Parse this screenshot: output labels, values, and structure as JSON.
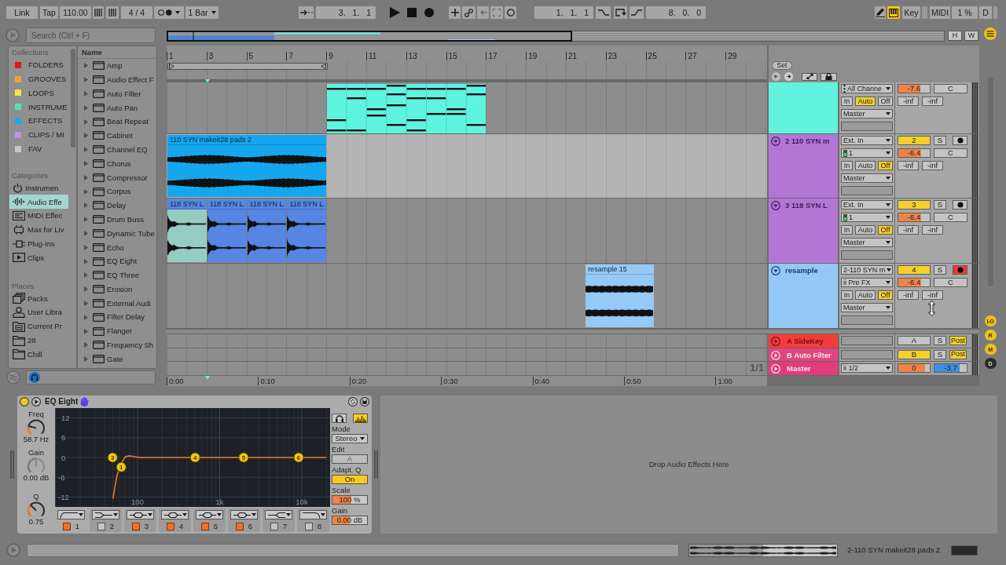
{
  "control_bar": {
    "link": "Link",
    "tap": "Tap",
    "tempo": "110.00",
    "signature": "4 / 4",
    "quantization": "1 Bar",
    "arrangement_position": "3. 1. 1",
    "loop_start": "1. 1. 1",
    "loop_length": "8. 0. 0",
    "draw_mode_on": false,
    "keys_on": true,
    "key": "Key",
    "midi": "MIDI",
    "cpu_load": "1 %",
    "disk_overload": "D"
  },
  "browser": {
    "search": {
      "placeholder": "Search (Ctrl + F)"
    },
    "collections": {
      "title": "Collections",
      "items": [
        {
          "label": "FOLDERS",
          "color": "#e3161d",
          "selected": false
        },
        {
          "label": "GROOVES",
          "color": "#f2a03c",
          "selected": false
        },
        {
          "label": "LOOPS",
          "color": "#f2e648",
          "selected": false
        },
        {
          "label": "INSTRUME",
          "color": "#4de6a6",
          "selected": false
        },
        {
          "label": "EFFECTS",
          "color": "#22a6f0",
          "selected": false
        },
        {
          "label": "CLIPS / MI",
          "color": "#b693f5",
          "selected": false
        },
        {
          "label": "FAV",
          "color": "#c6c6c6",
          "selected": false
        }
      ]
    },
    "categories": {
      "title": "Categories",
      "items": [
        {
          "label": "Instrumen",
          "selected": false
        },
        {
          "label": "Audio Effe",
          "selected": true
        },
        {
          "label": "MIDI Effec",
          "selected": false
        },
        {
          "label": "Max for Liv",
          "selected": false
        },
        {
          "label": "Plug-Ins",
          "selected": false
        },
        {
          "label": "Clips",
          "selected": false
        }
      ]
    },
    "places": {
      "title": "Places",
      "items": [
        {
          "label": "Packs",
          "selected": false
        },
        {
          "label": "User Libra",
          "selected": false
        },
        {
          "label": "Current Pr",
          "selected": false
        },
        {
          "label": "28",
          "selected": false
        },
        {
          "label": "Chill",
          "selected": false
        }
      ]
    },
    "name_header": "Name",
    "items": [
      {
        "label": "Amp",
        "selected": false
      },
      {
        "label": "Audio Effect F",
        "selected": false
      },
      {
        "label": "Auto Filter",
        "selected": false
      },
      {
        "label": "Auto Pan",
        "selected": false
      },
      {
        "label": "Beat Repeat",
        "selected": false
      },
      {
        "label": "Cabinet",
        "selected": false
      },
      {
        "label": "Channel EQ",
        "selected": false
      },
      {
        "label": "Chorus",
        "selected": false
      },
      {
        "label": "Compressor",
        "selected": false
      },
      {
        "label": "Corpus",
        "selected": false
      },
      {
        "label": "Delay",
        "selected": false
      },
      {
        "label": "Drum Buss",
        "selected": false
      },
      {
        "label": "Dynamic Tube",
        "selected": false
      },
      {
        "label": "Echo",
        "selected": false
      },
      {
        "label": "EQ Eight",
        "selected": false
      },
      {
        "label": "EQ Three",
        "selected": false
      },
      {
        "label": "Erosion",
        "selected": false
      },
      {
        "label": "External Audi",
        "selected": false
      },
      {
        "label": "Filter Delay",
        "selected": false
      },
      {
        "label": "Flanger",
        "selected": false
      },
      {
        "label": "Frequency Sh",
        "selected": false
      },
      {
        "label": "Gate",
        "selected": false
      }
    ]
  },
  "overview": {
    "h_button": "H",
    "w_button": "W"
  },
  "arrangement": {
    "bar_numbers": [
      "1",
      "3",
      "5",
      "7",
      "9",
      "11",
      "13",
      "15",
      "17",
      "19",
      "21",
      "23",
      "25",
      "27",
      "29"
    ],
    "set_button": "Set",
    "tracks": [
      {
        "color": "#62f3de",
        "selected": false,
        "clips": [
          {
            "kind": "midi",
            "color": "#5ef4e0",
            "selected": false
          }
        ],
        "input_channel": "All Channe",
        "monitor": [
          {
            "label": "In",
            "selected": false
          },
          {
            "label": "Auto",
            "selected": true
          },
          {
            "label": "Off",
            "selected": false
          }
        ],
        "output": "Master",
        "volume": {
          "value": "-7.6",
          "level": 0.7
        },
        "pan": "C",
        "sends": [
          "-inf",
          "-inf"
        ]
      },
      {
        "name": "2 110 SYN m",
        "color": "#b476d5",
        "selected": true,
        "clips": [
          {
            "kind": "audio",
            "name": "110 SYN makeit28 pads 2",
            "color": "#14a6ef",
            "selected": false
          }
        ],
        "input_type": "Ext. In",
        "input_channel": "1",
        "monitor": [
          {
            "label": "In",
            "selected": false
          },
          {
            "label": "Auto",
            "selected": false
          },
          {
            "label": "Off",
            "selected": true
          }
        ],
        "output": "Master",
        "activator": {
          "label": "2",
          "on": true
        },
        "solo": "S",
        "armed": false,
        "volume": {
          "value": "-6.4",
          "level": 0.72
        },
        "pan": "C",
        "sends": [
          "-inf",
          "-inf"
        ]
      },
      {
        "name": "3 118 SYN L",
        "color": "#b476d5",
        "selected": false,
        "clips": [
          {
            "kind": "audio",
            "name": "118 SYN L",
            "color": "#5685e2",
            "selected": true
          },
          {
            "kind": "audio",
            "name": "118 SYN L",
            "color": "#5685e2",
            "selected": false
          },
          {
            "kind": "audio",
            "name": "118 SYN L",
            "color": "#5685e2",
            "selected": false
          },
          {
            "kind": "audio",
            "name": "118 SYN L",
            "color": "#5685e2",
            "selected": false
          }
        ],
        "input_type": "Ext. In",
        "input_channel": "1",
        "monitor": [
          {
            "label": "In",
            "selected": false
          },
          {
            "label": "Auto",
            "selected": false
          },
          {
            "label": "Off",
            "selected": true
          }
        ],
        "output": "Master",
        "activator": {
          "label": "3",
          "on": true
        },
        "solo": "S",
        "armed": false,
        "volume": {
          "value": "-6.4",
          "level": 0.72
        },
        "pan": "C",
        "sends": [
          "-inf",
          "-inf"
        ]
      },
      {
        "name": "resample",
        "color": "#93c8f7",
        "selected": false,
        "clips": [
          {
            "kind": "audio",
            "name": "resample 15",
            "color": "#94c9f8",
            "selected": false
          }
        ],
        "input_type": "2-110 SYN m",
        "input_channel": "ii Pre FX",
        "monitor": [
          {
            "label": "In",
            "selected": false
          },
          {
            "label": "Auto",
            "selected": false
          },
          {
            "label": "Off",
            "selected": true
          }
        ],
        "output": "Master",
        "activator": {
          "label": "4",
          "on": true
        },
        "solo": "S",
        "armed": true,
        "volume": {
          "value": "-6.4",
          "level": 0.72
        },
        "pan": "C",
        "sends": [
          "-inf",
          "-inf"
        ]
      }
    ],
    "returns": [
      {
        "kind": "return",
        "name": "A SideKey",
        "color": "#f23c3c",
        "activator": {
          "label": "A",
          "on": false
        },
        "solo": "S",
        "post": {
          "label": "Post",
          "on": true
        }
      },
      {
        "kind": "return",
        "name": "B Auto Filter",
        "color": "#e2447d",
        "activator": {
          "label": "B",
          "on": true
        },
        "solo": "S",
        "post": {
          "label": "Post",
          "on": true
        }
      },
      {
        "kind": "master",
        "name": "Master",
        "color": "#e03c7b",
        "output": "ii 1/2",
        "volume": {
          "value": "0",
          "level": 0.86
        },
        "cue": {
          "value": "-3.7",
          "level": 0.78
        }
      }
    ],
    "page_indicator": "1/1",
    "time_labels": [
      "0:00",
      "0:10",
      "0:20",
      "0:30",
      "0:40",
      "0:50",
      "1:00"
    ]
  },
  "side_buttons": [
    {
      "label": "I-O",
      "on": true
    },
    {
      "label": "R",
      "on": true
    },
    {
      "label": "M",
      "on": true
    },
    {
      "label": "D",
      "on": false
    }
  ],
  "device": {
    "title": "EQ Eight",
    "on": true,
    "knobs": [
      {
        "label": "Freq",
        "value": "58.7 Hz",
        "level": 0.22,
        "disabled": false
      },
      {
        "label": "Gain",
        "value": "0.00 dB",
        "level": 0.5,
        "disabled": true
      },
      {
        "label": "Q",
        "value": "0.75",
        "level": 0.33,
        "disabled": false
      }
    ],
    "chart_data": {
      "type": "line",
      "categories": [
        null,
        null,
        null,
        null,
        null,
        null,
        null,
        null,
        null,
        null,
        null,
        null,
        null,
        null,
        null,
        null,
        null,
        null,
        "100",
        null,
        null,
        null,
        null,
        null,
        null,
        null,
        null,
        null,
        null,
        null,
        null,
        null,
        null,
        null,
        null,
        null,
        null,
        null,
        "1k",
        null,
        null,
        null,
        null,
        null,
        null,
        null,
        null,
        null,
        null,
        null,
        null,
        null,
        null,
        null,
        null,
        null,
        null,
        null,
        "10k",
        null,
        null,
        null,
        null,
        null,
        null
      ],
      "series": [
        {
          "color": "#e8782e",
          "values": [
            null,
            null,
            null,
            null,
            null,
            null,
            null,
            null,
            null,
            null,
            null,
            null,
            -12.5,
            -5.4,
            -1.9,
            0.2,
            0.5,
            0.3,
            0.1,
            0,
            0,
            0,
            0,
            0,
            0,
            0,
            0,
            0,
            0,
            0,
            0,
            0,
            0,
            0,
            0,
            0,
            0,
            0,
            0,
            0,
            0,
            0,
            0,
            0,
            0,
            0,
            0,
            0,
            0,
            0,
            0,
            0,
            0,
            0,
            0,
            0,
            0,
            0,
            0,
            0,
            0,
            0,
            0,
            0,
            0
          ]
        }
      ],
      "ylim": [
        -15,
        15
      ],
      "yticks": [
        12,
        6,
        0,
        -6,
        -12
      ],
      "grid": true,
      "annotations": [
        "3",
        "1",
        "4",
        "5",
        "6"
      ]
    },
    "bands": [
      {
        "number": "1",
        "on": true,
        "selected": true
      },
      {
        "number": "2",
        "on": false,
        "selected": false
      },
      {
        "number": "3",
        "on": true,
        "selected": false
      },
      {
        "number": "4",
        "on": true,
        "selected": false
      },
      {
        "number": "5",
        "on": true,
        "selected": false
      },
      {
        "number": "6",
        "on": true,
        "selected": false
      },
      {
        "number": "7",
        "on": false,
        "selected": false
      },
      {
        "number": "8",
        "on": false,
        "selected": false
      }
    ],
    "listen_on": false,
    "spectrum_on": true,
    "mode": {
      "label": "Mode",
      "value": "Stereo"
    },
    "edit": {
      "label": "Edit",
      "value": "A",
      "disabled": true
    },
    "adapt_q": {
      "label": "Adapt. Q",
      "value": "On",
      "on": true
    },
    "scale": {
      "label": "Scale",
      "value": "100 %",
      "level": 0.54
    },
    "output_gain": {
      "label": "Gain",
      "value": "0.00 dB",
      "level": 0.5
    }
  },
  "drop_hint": "Drop Audio Effects Here",
  "status_bar": {
    "clip_name": "2-110 SYN makeit28 pads 2"
  }
}
